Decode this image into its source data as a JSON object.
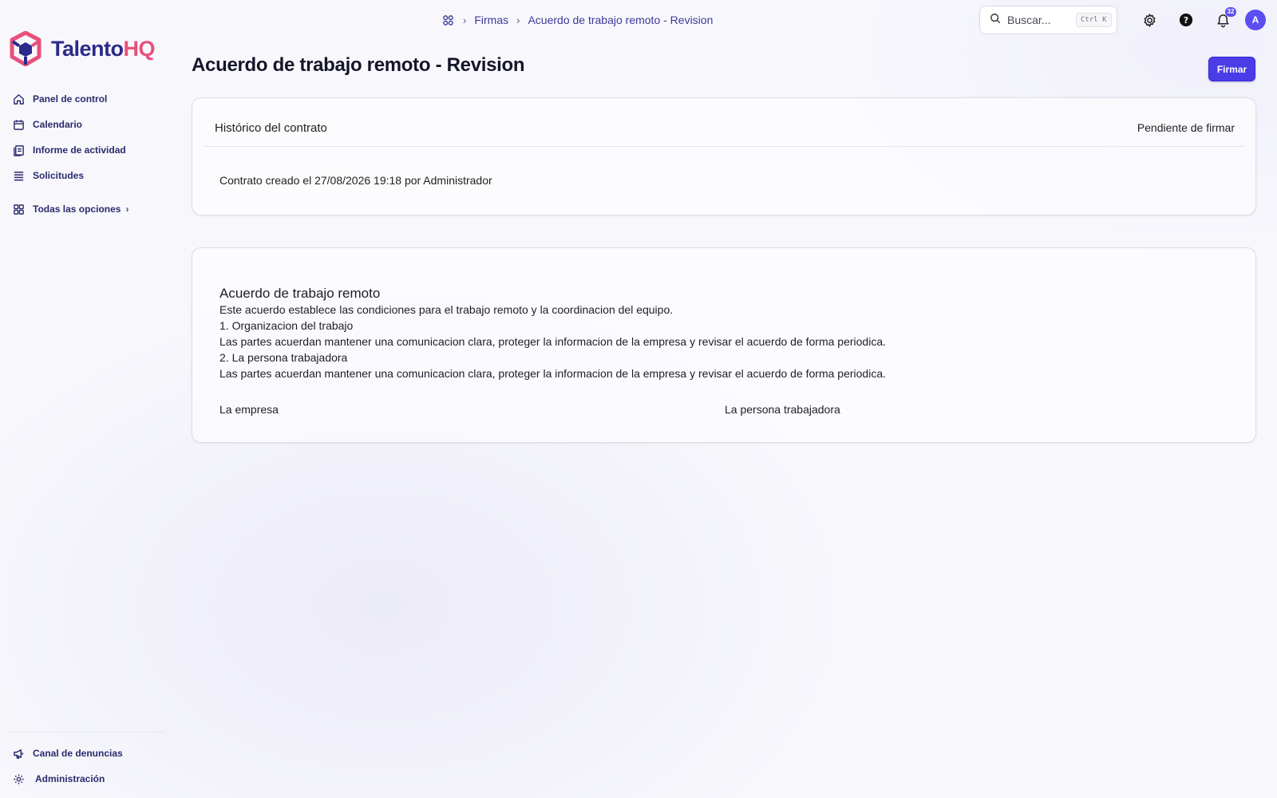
{
  "app": {
    "logo_primary": "Talento",
    "logo_accent": "HQ",
    "brand_color": "#2b2a8a",
    "accent_color": "#e8507b",
    "primary_button_color": "#4a3ce6"
  },
  "sidebar": {
    "items": [
      {
        "label": "Panel de control",
        "icon": "home-icon"
      },
      {
        "label": "Calendario",
        "icon": "calendar-icon"
      },
      {
        "label": "Informe de actividad",
        "icon": "report-icon"
      },
      {
        "label": "Solicitudes",
        "icon": "list-icon"
      }
    ],
    "all_options": {
      "label": "Todas las opciones",
      "icon": "grid-icon"
    },
    "bottom_items": [
      {
        "label": "Canal de denuncias",
        "icon": "megaphone-icon"
      },
      {
        "label": "Administración",
        "icon": "gear-icon"
      }
    ]
  },
  "topbar": {
    "breadcrumb": [
      "Firmas",
      "Acuerdo de trabajo remoto - Revision"
    ],
    "search": {
      "placeholder": "Buscar...",
      "shortcut": "Ctrl K"
    },
    "notification_count": "32",
    "avatar_initial": "A"
  },
  "page": {
    "title": "Acuerdo de trabajo remoto - Revision",
    "sign_button": "Firmar"
  },
  "history_card": {
    "title": "Histórico del contrato",
    "status": "Pendiente de firmar",
    "entry": "Contrato creado el 27/08/2026 19:18 por Administrador"
  },
  "document": {
    "title": "Acuerdo de trabajo remoto",
    "intro": "Este acuerdo establece las condiciones para el trabajo remoto y la coordinacion del equipo.",
    "section1_heading": "1. Organizacion del trabajo",
    "section1_text": "Las partes acuerdan mantener una comunicacion clara, proteger la informacion de la empresa y revisar el acuerdo de forma periodica.",
    "section2_heading": "2. La persona trabajadora",
    "section2_text": "Las partes acuerdan mantener una comunicacion clara, proteger la informacion de la empresa y revisar el acuerdo de forma periodica.",
    "signature_company": "La empresa",
    "signature_worker": "La persona trabajadora"
  }
}
